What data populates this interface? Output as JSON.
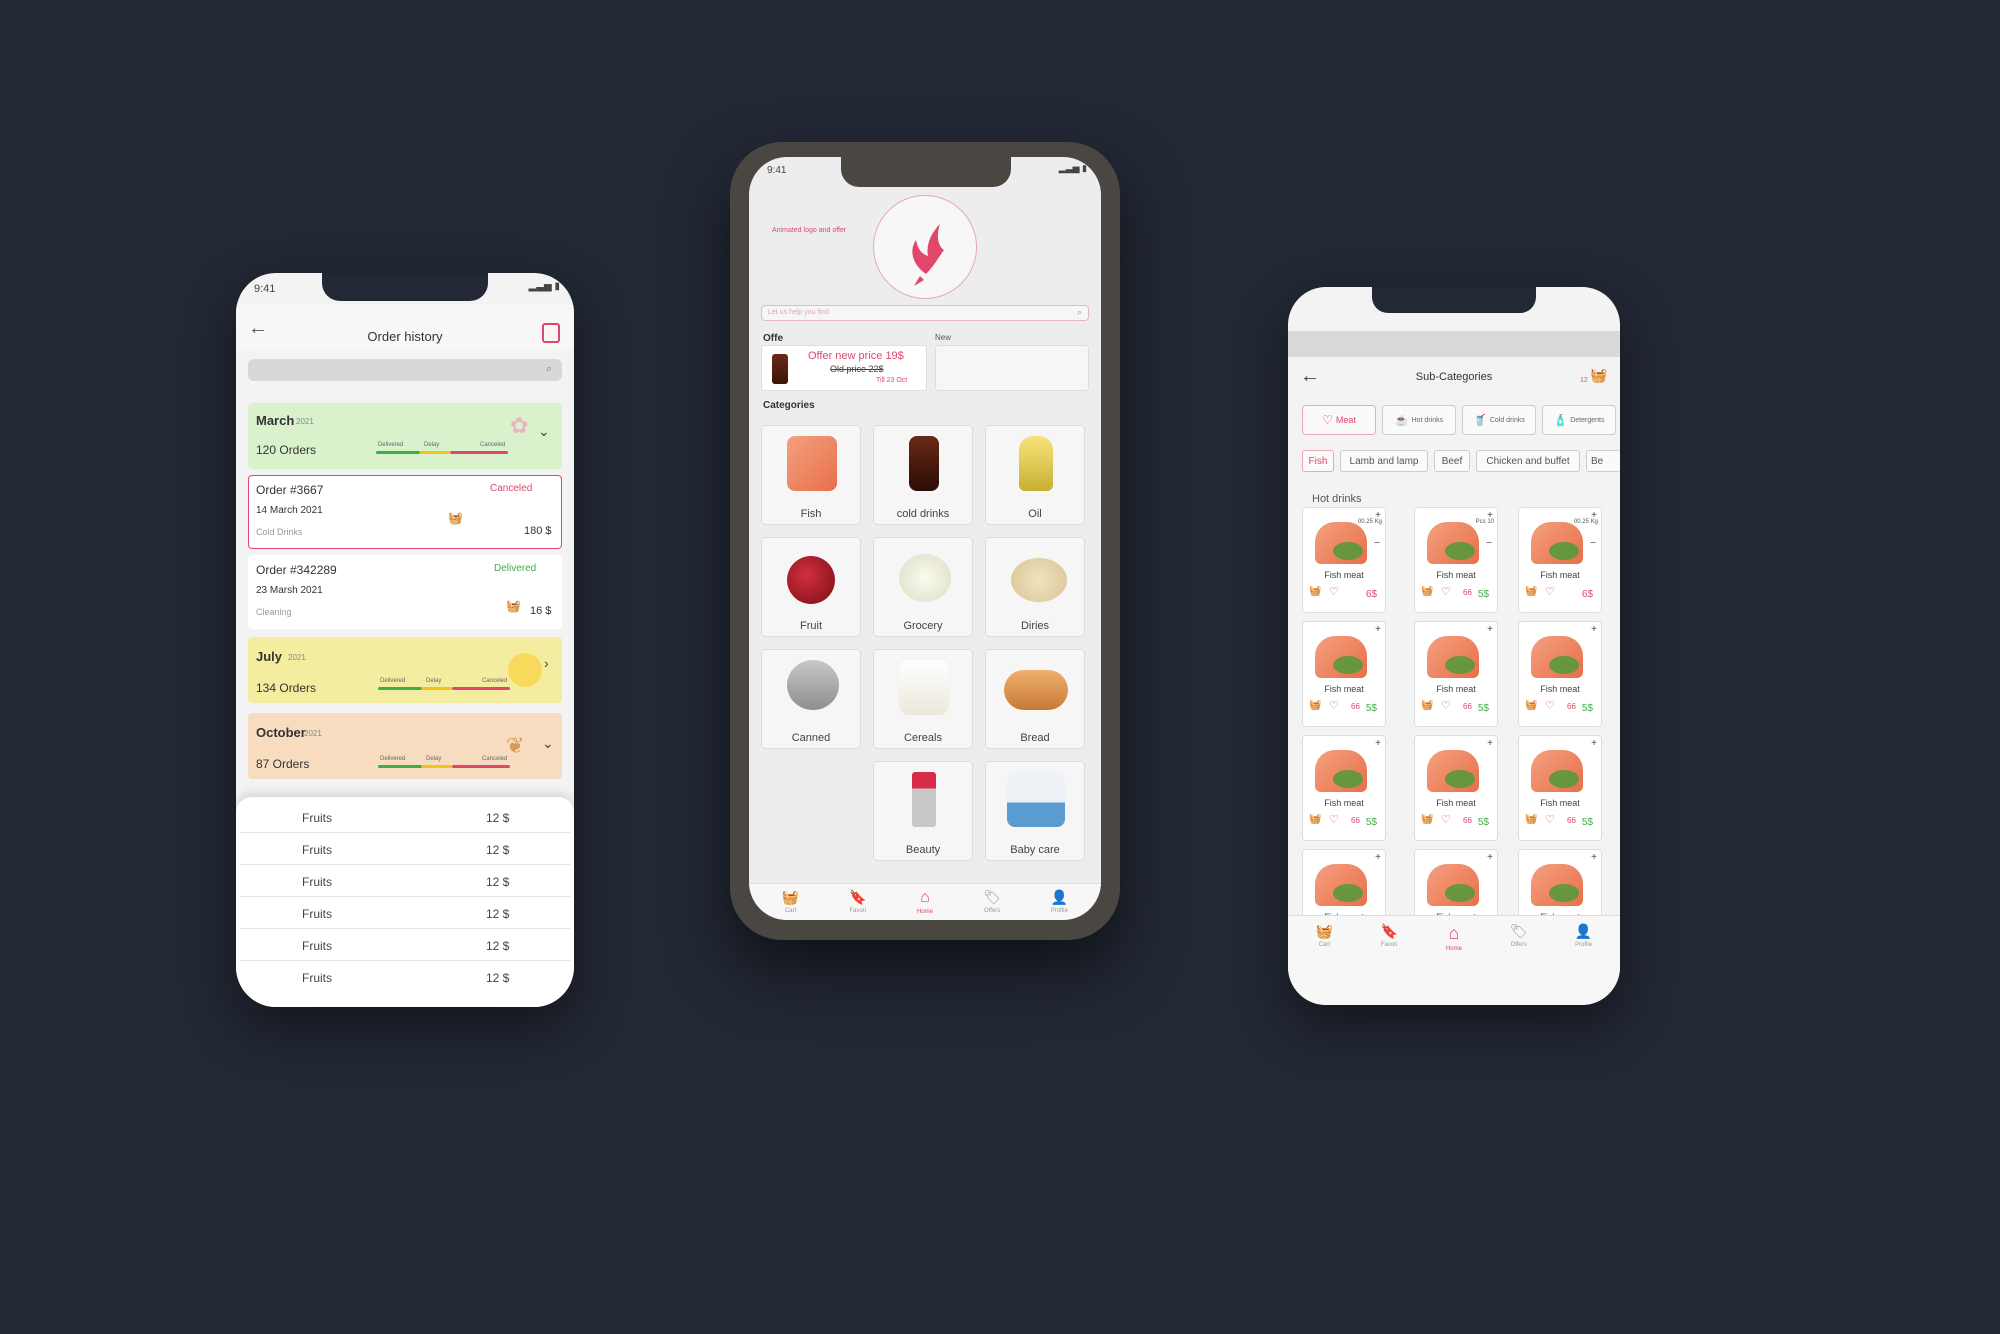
{
  "colors": {
    "background": "#222834",
    "accent": "#e0476a",
    "delivered": "#3fae49",
    "canceled": "#e0476a",
    "delay": "#f0c419"
  },
  "left": {
    "status_time": "9:41",
    "title": "Order history",
    "back_icon": "back-arrow-icon",
    "calendar_icon": "calendar-icon",
    "march": {
      "month": "March",
      "year": "2021",
      "count": "120 Orders",
      "bar": [
        "Delivered",
        "Delay",
        "Canceled"
      ]
    },
    "order1": {
      "id": "Order #3667",
      "status": "Canceled",
      "date": "14 March 2021",
      "category": "Cold Drinks",
      "total": "180 $"
    },
    "order2": {
      "id": "Order #342289",
      "status": "Delivered",
      "date": "23 Marsh 2021",
      "category": "Cleaning",
      "total": "16 $"
    },
    "july": {
      "month": "July",
      "year": "2021",
      "count": "134 Orders",
      "bar": [
        "Delivered",
        "Delay",
        "Canceled"
      ]
    },
    "october": {
      "month": "October",
      "year": "2021",
      "count": "87 Orders",
      "bar": [
        "Delivered",
        "Delay",
        "Canceled"
      ]
    },
    "rows": [
      {
        "name": "Fruits",
        "price": "12 $"
      },
      {
        "name": "Fruits",
        "price": "12 $"
      },
      {
        "name": "Fruits",
        "price": "12 $"
      },
      {
        "name": "Fruits",
        "price": "12 $"
      },
      {
        "name": "Fruits",
        "price": "12 $"
      },
      {
        "name": "Fruits",
        "price": "12 $"
      }
    ]
  },
  "center": {
    "status_time": "9:41",
    "logo_caption": "Animated logo and offer",
    "search_placeholder": "Let us help you find",
    "offer_label": "Offe",
    "new_label": "New",
    "offer": {
      "new_price": "Offer new price 19$",
      "old_price": "Old price 22$",
      "till": "Till 23 Oct"
    },
    "categories_label": "Categories",
    "categories": [
      "Fish",
      "cold drinks",
      "Oil",
      "Fruit",
      "Grocery",
      "Diries",
      "Canned",
      "Cereals",
      "Bread",
      "Beauty",
      "Baby care"
    ],
    "nav": [
      "Cart",
      "Favori",
      "Home",
      "Offers",
      "Profile"
    ]
  },
  "right": {
    "title": "Sub-Categories",
    "cart_count": "12",
    "chips": [
      "Meat",
      "Hot drinks",
      "Cold drinks",
      "Detergents"
    ],
    "subs": [
      "Fish",
      "Lamb and lamp",
      "Beef",
      "Chicken and buffet",
      "Be"
    ],
    "section": "Hot drinks",
    "product_name": "Fish meat",
    "qty_kg": "00.25 Kg",
    "qty_pcs": "Pcs 10",
    "price_a": "6$",
    "price_b": "5$",
    "discount": "66",
    "nav": [
      "Cart",
      "Favori",
      "Home",
      "Offers",
      "Profile"
    ]
  }
}
